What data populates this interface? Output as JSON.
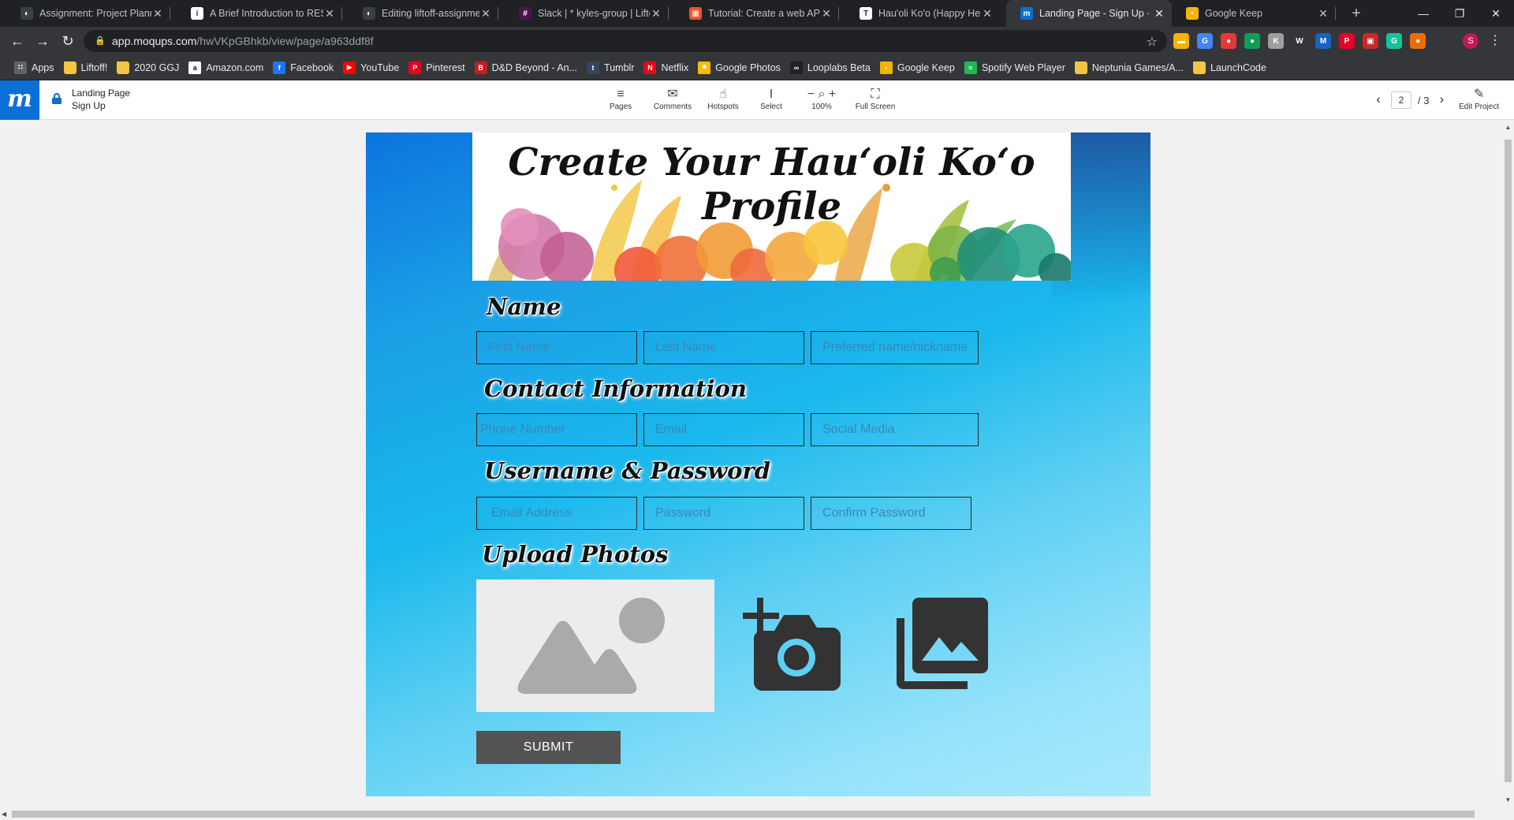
{
  "browser": {
    "tabs": [
      {
        "title": "Assignment: Project Plannin",
        "favicon": "github-icon",
        "color": "#3c4043",
        "glyph": "◐"
      },
      {
        "title": "A Brief Introduction to REST",
        "favicon": "infoq-icon",
        "color": "#ffffff",
        "glyph": "i"
      },
      {
        "title": "Editing liftoff-assignments/",
        "favicon": "github-icon",
        "color": "#3c4043",
        "glyph": "◐"
      },
      {
        "title": "Slack | * kyles-group | Liftof",
        "favicon": "slack-icon",
        "color": "#4a154b",
        "glyph": "#"
      },
      {
        "title": "Tutorial: Create a web API w",
        "favicon": "microsoft-icon",
        "color": "#f35325",
        "glyph": "▦"
      },
      {
        "title": "Hau'oli Ko'o (Happy Helper)",
        "favicon": "document-icon",
        "color": "#ffffff",
        "glyph": "T"
      },
      {
        "title": "Landing Page - Sign Up · Mo",
        "favicon": "moqups-icon",
        "color": "#0b6fd8",
        "glyph": "m"
      },
      {
        "title": "Google Keep",
        "favicon": "google-keep-icon",
        "color": "#f4b400",
        "glyph": "•"
      }
    ],
    "active_tab_index": 6,
    "new_tab_label": "+",
    "url_host": "app.moqups.com",
    "url_path": "/hwVKpGBhkb/view/page/a963ddf8f",
    "bookmarks": [
      {
        "label": "Apps",
        "icon": "apps-grid-icon",
        "color": "#5f6368",
        "glyph": "∷"
      },
      {
        "label": "Liftoff!",
        "icon": "folder-icon",
        "color": "#f4c542",
        "glyph": ""
      },
      {
        "label": "2020 GGJ",
        "icon": "folder-icon",
        "color": "#f4c542",
        "glyph": ""
      },
      {
        "label": "Amazon.com",
        "icon": "amazon-icon",
        "color": "#ffffff",
        "glyph": "a"
      },
      {
        "label": "Facebook",
        "icon": "facebook-icon",
        "color": "#1877f2",
        "glyph": "f"
      },
      {
        "label": "YouTube",
        "icon": "youtube-icon",
        "color": "#ff0000",
        "glyph": "▶"
      },
      {
        "label": "Pinterest",
        "icon": "pinterest-icon",
        "color": "#e60023",
        "glyph": "P"
      },
      {
        "label": "D&D Beyond - An...",
        "icon": "dndbeyond-icon",
        "color": "#c41e1e",
        "glyph": "B"
      },
      {
        "label": "Tumblr",
        "icon": "tumblr-icon",
        "color": "#35465c",
        "glyph": "t"
      },
      {
        "label": "Netflix",
        "icon": "netflix-icon",
        "color": "#e50914",
        "glyph": "N"
      },
      {
        "label": "Google Photos",
        "icon": "google-photos-icon",
        "color": "#fbbc04",
        "glyph": "✸"
      },
      {
        "label": "Looplabs Beta",
        "icon": "looplabs-icon",
        "color": "#222222",
        "glyph": "∞"
      },
      {
        "label": "Google Keep",
        "icon": "google-keep-icon",
        "color": "#f4b400",
        "glyph": "•"
      },
      {
        "label": "Spotify Web Player",
        "icon": "spotify-icon",
        "color": "#1db954",
        "glyph": "≈"
      },
      {
        "label": "Neptunia Games/A...",
        "icon": "folder-icon",
        "color": "#f4c542",
        "glyph": ""
      },
      {
        "label": "LaunchCode",
        "icon": "folder-icon",
        "color": "#f4c542",
        "glyph": ""
      }
    ],
    "extensions": [
      {
        "icon": "extension-yellow-icon",
        "color": "#f4b400",
        "glyph": "▬"
      },
      {
        "icon": "translate-icon",
        "color": "#4285f4",
        "glyph": "G"
      },
      {
        "icon": "extension-red-icon",
        "color": "#e53935",
        "glyph": "●"
      },
      {
        "icon": "extension-green-icon",
        "color": "#0f9d58",
        "glyph": "●"
      },
      {
        "icon": "extension-grey-icon",
        "color": "#9e9e9e",
        "glyph": "K"
      },
      {
        "icon": "extension-w-icon",
        "color": "#35363a",
        "glyph": "W"
      },
      {
        "icon": "extension-m-icon",
        "color": "#1565c0",
        "glyph": "M"
      },
      {
        "icon": "pinterest-icon",
        "color": "#e60023",
        "glyph": "P"
      },
      {
        "icon": "extension-red2-icon",
        "color": "#c62828",
        "glyph": "▣"
      },
      {
        "icon": "grammarly-icon",
        "color": "#15c39a",
        "glyph": "G"
      },
      {
        "icon": "extension-orange-icon",
        "color": "#ef6c00",
        "glyph": "●"
      }
    ],
    "profile_initial": "S"
  },
  "moqups": {
    "logo": "m",
    "page_title_line1": "Landing Page",
    "page_title_line2": "Sign Up",
    "tools": [
      {
        "label": "Pages",
        "icon": "pages-icon",
        "glyph": "≡"
      },
      {
        "label": "Comments",
        "icon": "comment-icon",
        "glyph": "✉"
      },
      {
        "label": "Hotspots",
        "icon": "hand-pointer-icon",
        "glyph": "☝"
      },
      {
        "label": "Select",
        "icon": "text-cursor-icon",
        "glyph": "I"
      },
      {
        "label": "100%",
        "icon": "zoom-icon",
        "glyph": "− ⌕ +"
      },
      {
        "label": "Full Screen",
        "icon": "fullscreen-icon",
        "glyph": "⛶"
      }
    ],
    "pager_current": "2",
    "pager_total": "/ 3",
    "edit_label": "Edit Project"
  },
  "form": {
    "banner_title": "Create Your Hauʻoli Koʻo Profile",
    "sections": {
      "name": "Name",
      "contact": "Contact Information",
      "credentials": "Username & Password",
      "photos": "Upload Photos"
    },
    "fields": {
      "first_name": "First Name",
      "last_name": "Last Name",
      "preferred_name": "Preferred name/nickname",
      "phone": "Phone Number",
      "email": "Email",
      "social": "Social Media",
      "email_address": "Email Address",
      "password": "Password",
      "confirm_password": "Confirm Password"
    },
    "submit_label": "SUBMIT"
  }
}
